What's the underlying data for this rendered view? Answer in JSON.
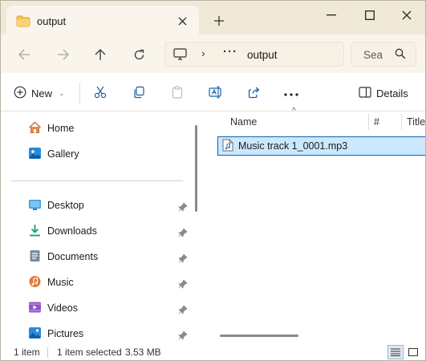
{
  "window": {
    "tab_title": "output",
    "controls": [
      "minimize",
      "maximize",
      "close"
    ]
  },
  "address": {
    "crumbs": [
      "output"
    ],
    "overflow": "···"
  },
  "search": {
    "placeholder": "Sea"
  },
  "toolbar": {
    "new_label": "New",
    "details_label": "Details"
  },
  "sidebar": {
    "items": [
      {
        "label": "Home",
        "icon": "home-icon"
      },
      {
        "label": "Gallery",
        "icon": "gallery-icon"
      },
      {
        "label": "Desktop",
        "icon": "desktop-icon",
        "pinned": true
      },
      {
        "label": "Downloads",
        "icon": "downloads-icon",
        "pinned": true
      },
      {
        "label": "Documents",
        "icon": "documents-icon",
        "pinned": true
      },
      {
        "label": "Music",
        "icon": "music-icon",
        "pinned": true
      },
      {
        "label": "Videos",
        "icon": "videos-icon",
        "pinned": true
      },
      {
        "label": "Pictures",
        "icon": "pictures-icon",
        "pinned": true
      }
    ]
  },
  "list": {
    "columns": [
      "Name",
      "#",
      "Title"
    ],
    "sort_column": "Name",
    "files": [
      {
        "name": "Music track 1_0001.mp3",
        "selected": true
      }
    ]
  },
  "status": {
    "count": "1 item",
    "selection": "1 item selected",
    "size": "3.53 MB"
  },
  "colors": {
    "titlebar": "#f1e9d7",
    "selection": "#cce8ff",
    "selection_border": "#0b63b4",
    "folder": "#f2c55c"
  }
}
